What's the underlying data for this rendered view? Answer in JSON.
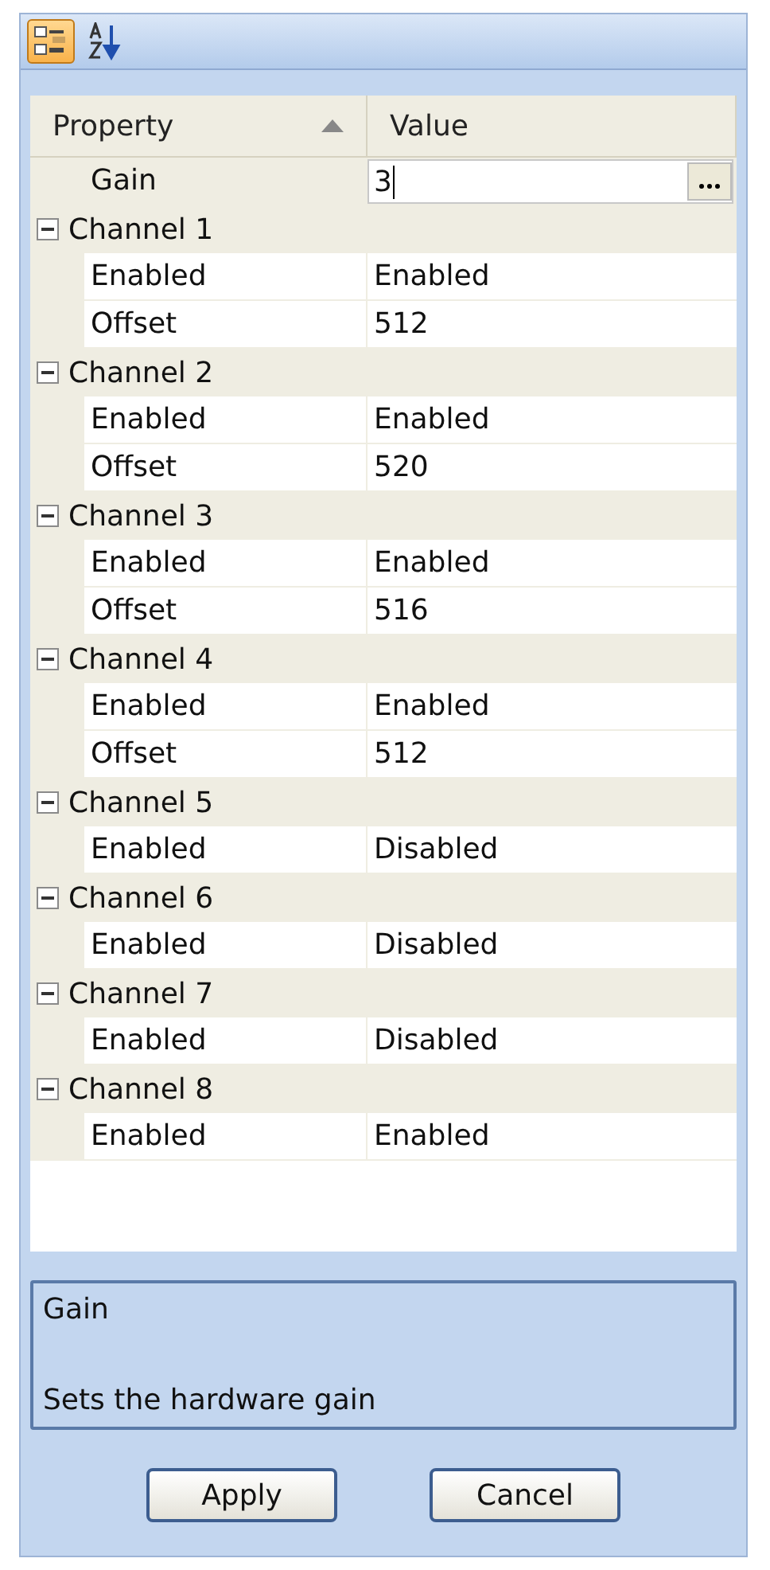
{
  "toolbar": [
    {
      "kind": "categorized",
      "selected": true
    },
    {
      "kind": "alphabetical",
      "selected": false
    }
  ],
  "columns": [
    {
      "label": "Property",
      "sorted": true
    },
    {
      "label": "Value",
      "sorted": false
    }
  ],
  "top_property": {
    "name": "Gain",
    "value": "3",
    "editing": true
  },
  "categories": [
    {
      "name": "Channel 1",
      "expanded": true,
      "children": [
        {
          "name": "Enabled",
          "value": "Enabled"
        },
        {
          "name": "Offset",
          "value": "512"
        }
      ]
    },
    {
      "name": "Channel 2",
      "expanded": true,
      "children": [
        {
          "name": "Enabled",
          "value": "Enabled"
        },
        {
          "name": "Offset",
          "value": "520"
        }
      ]
    },
    {
      "name": "Channel 3",
      "expanded": true,
      "children": [
        {
          "name": "Enabled",
          "value": "Enabled"
        },
        {
          "name": "Offset",
          "value": "516"
        }
      ]
    },
    {
      "name": "Channel 4",
      "expanded": true,
      "children": [
        {
          "name": "Enabled",
          "value": "Enabled"
        },
        {
          "name": "Offset",
          "value": "512"
        }
      ]
    },
    {
      "name": "Channel 5",
      "expanded": true,
      "children": [
        {
          "name": "Enabled",
          "value": "Disabled"
        }
      ]
    },
    {
      "name": "Channel 6",
      "expanded": true,
      "children": [
        {
          "name": "Enabled",
          "value": "Disabled"
        }
      ]
    },
    {
      "name": "Channel 7",
      "expanded": true,
      "children": [
        {
          "name": "Enabled",
          "value": "Disabled"
        }
      ]
    },
    {
      "name": "Channel 8",
      "expanded": true,
      "children": [
        {
          "name": "Enabled",
          "value": "Enabled"
        }
      ]
    }
  ],
  "description": {
    "title": "Gain",
    "text": "Sets the hardware gain"
  },
  "buttons": [
    "Apply",
    "Cancel"
  ]
}
